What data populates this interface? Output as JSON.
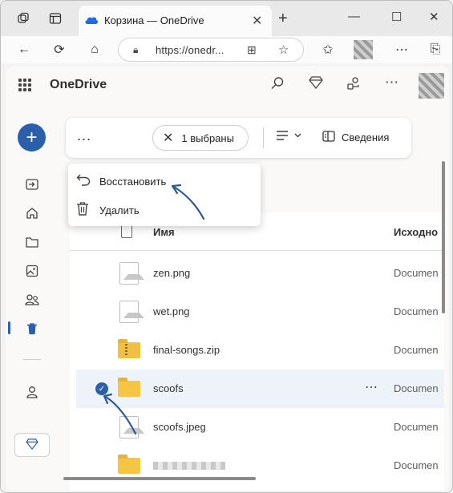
{
  "browser": {
    "tab_title": "Корзина — OneDrive",
    "url_visible": "https://onedr...",
    "tab_close_icon": "close-icon",
    "new_tab_icon": "plus-icon"
  },
  "app": {
    "brand": "OneDrive",
    "accent": "#2c5fab"
  },
  "commandbar": {
    "more_label": "...",
    "selection_label": "1 выбраны",
    "details_label": "Сведения"
  },
  "context_menu": {
    "items": [
      {
        "label": "Восстановить",
        "icon": "restore-icon"
      },
      {
        "label": "Удалить",
        "icon": "trash-icon"
      }
    ]
  },
  "list": {
    "columns": {
      "name": "Имя",
      "source": "Исходно"
    },
    "rows": [
      {
        "name": "zen.png",
        "source": "Documen",
        "type": "image",
        "selected": false
      },
      {
        "name": "wet.png",
        "source": "Documen",
        "type": "image",
        "selected": false
      },
      {
        "name": "final-songs.zip",
        "source": "Documen",
        "type": "zip",
        "selected": false
      },
      {
        "name": "scoofs",
        "source": "Documen",
        "type": "folder",
        "selected": true
      },
      {
        "name": "scoofs.jpeg",
        "source": "Documen",
        "type": "image",
        "selected": false
      },
      {
        "name": "",
        "source": "Documen",
        "type": "folder",
        "selected": false
      }
    ]
  }
}
